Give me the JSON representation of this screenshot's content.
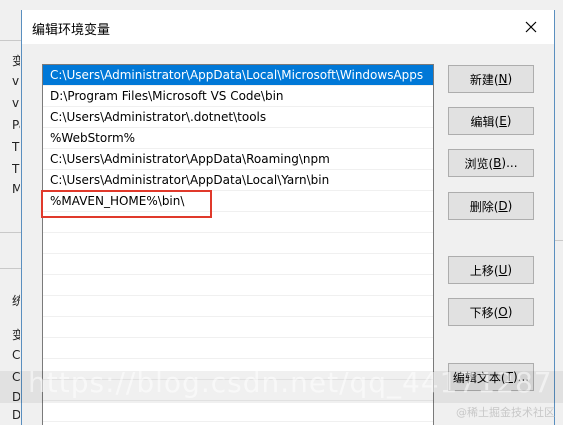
{
  "background_window": {
    "chars": [
      "变",
      "v",
      "v",
      "Pa",
      "T",
      "T",
      "M",
      "统",
      "变",
      "Cl",
      "Co",
      "D",
      "Di"
    ]
  },
  "dialog": {
    "title": "编辑环境变量",
    "close_icon": "close-icon"
  },
  "list": {
    "items": [
      "C:\\Users\\Administrator\\AppData\\Local\\Microsoft\\WindowsApps",
      "D:\\Program Files\\Microsoft VS Code\\bin",
      "C:\\Users\\Administrator\\.dotnet\\tools",
      "%WebStorm%",
      "C:\\Users\\Administrator\\AppData\\Roaming\\npm",
      "C:\\Users\\Administrator\\AppData\\Local\\Yarn\\bin",
      "%MAVEN_HOME%\\bin\\",
      "",
      "",
      "",
      "",
      "",
      "",
      "",
      "",
      "",
      ""
    ],
    "selected_index": 0,
    "highlighted_index": 6
  },
  "buttons": {
    "new": {
      "label": "新建(",
      "accel": "N",
      "end": ")"
    },
    "edit": {
      "label": "编辑(",
      "accel": "E",
      "end": ")"
    },
    "browse": {
      "label": "浏览(",
      "accel": "B",
      "end": ")..."
    },
    "delete": {
      "label": "删除(",
      "accel": "D",
      "end": ")"
    },
    "move_up": {
      "label": "上移(",
      "accel": "U",
      "end": ")"
    },
    "move_down": {
      "label": "下移(",
      "accel": "O",
      "end": ")"
    },
    "edit_text": {
      "label": "编辑文本(",
      "accel": "T",
      "end": ")..."
    }
  },
  "watermark": {
    "text": "https://blog.csdn.net/qq_44171287",
    "brand": "@稀土掘金技术社区"
  },
  "colors": {
    "selection": "#0078d7",
    "highlight_box": "#e0392b",
    "window_border": "#5a8fbf"
  }
}
